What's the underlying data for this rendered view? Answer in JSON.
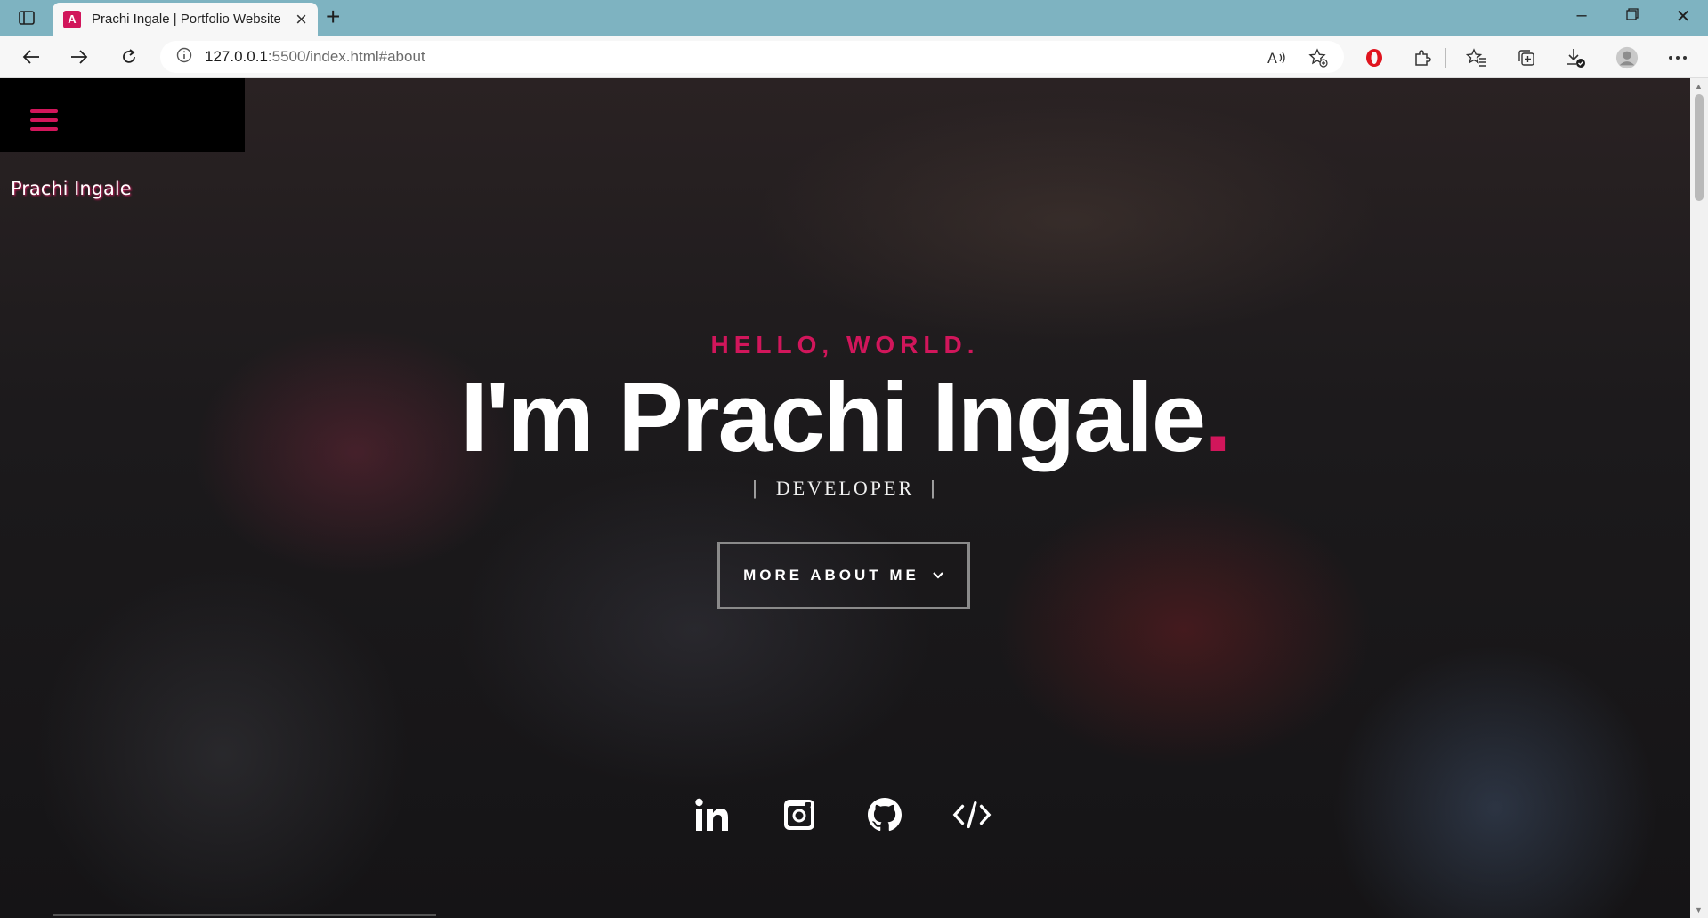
{
  "browser": {
    "tab_title": "Prachi Ingale | Portfolio Website",
    "favicon_letter": "A",
    "url_host": "127.0.0.1",
    "url_rest": ":5500/index.html#about"
  },
  "site": {
    "brand": "Prachi Ingale",
    "hero": {
      "greeting": "HELLO, WORLD.",
      "name": "I'm Prachi Ingale",
      "name_dot": ".",
      "role": "DEVELOPER",
      "role_divider": "|",
      "cta_label": "MORE ABOUT ME",
      "cta_icon": "chevron-down-icon"
    },
    "social_links": [
      {
        "name": "linkedin-icon"
      },
      {
        "name": "instagram-icon"
      },
      {
        "name": "github-icon"
      },
      {
        "name": "code-icon"
      }
    ],
    "colors": {
      "accent": "#d1165b",
      "text": "#ffffff",
      "menu_bg": "#000000"
    }
  }
}
